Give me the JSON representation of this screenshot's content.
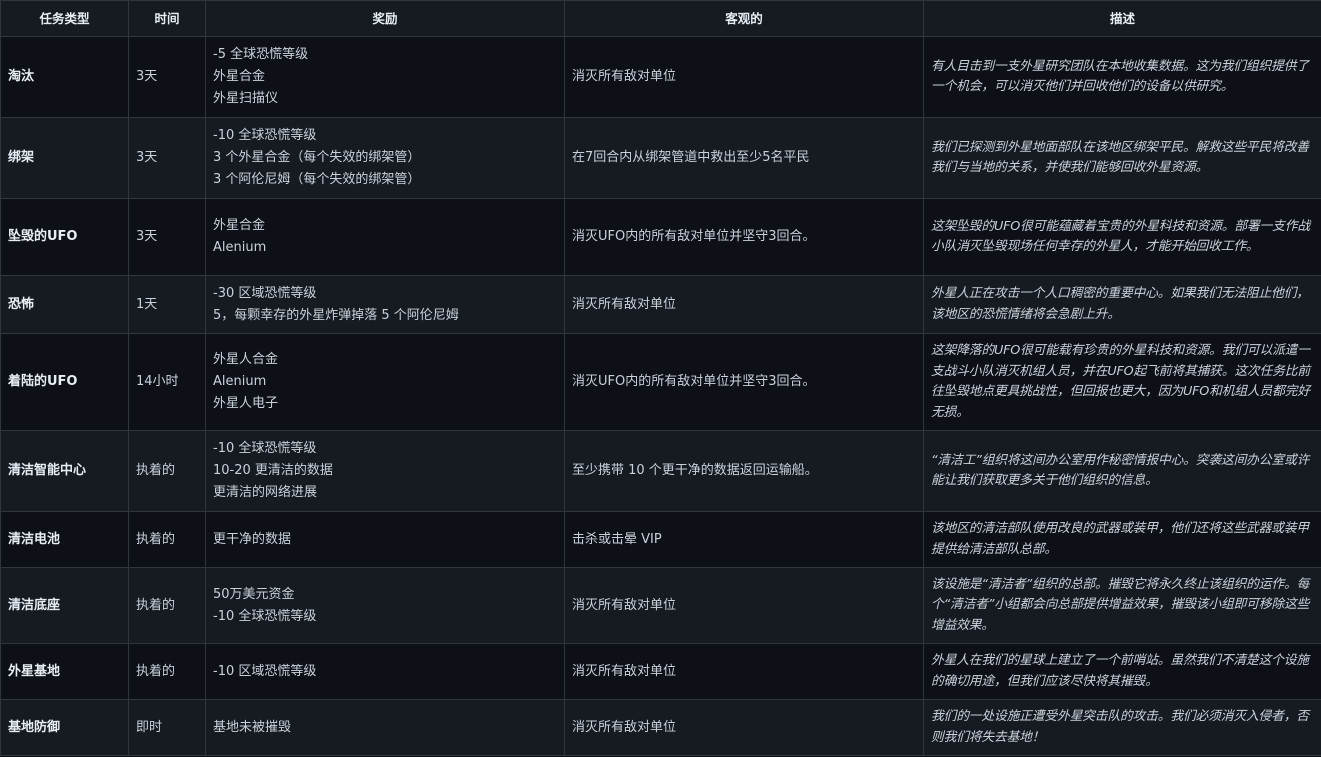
{
  "headers": [
    "任务类型",
    "时间",
    "奖励",
    "客观的",
    "描述"
  ],
  "rows": [
    {
      "type": "淘汰",
      "time": "3天",
      "rewards": [
        "-5 全球恐慌等级",
        "外星合金",
        "外星扫描仪"
      ],
      "objective": "消灭所有敌对单位",
      "description": "有人目击到一支外星研究团队在本地收集数据。这为我们组织提供了一个机会，可以消灭他们并回收他们的设备以供研究。"
    },
    {
      "type": "绑架",
      "time": "3天",
      "rewards": [
        "-10 全球恐慌等级",
        "3 个外星合金（每个失效的绑架管）",
        "3 个阿伦尼姆（每个失效的绑架管）"
      ],
      "objective": "在7回合内从绑架管道中救出至少5名平民",
      "description": "我们已探测到外星地面部队在该地区绑架平民。解救这些平民将改善我们与当地的关系，并使我们能够回收外星资源。"
    },
    {
      "type": "坠毁的UFO",
      "time": "3天",
      "rewards": [
        "外星合金",
        "Alenium"
      ],
      "objective": "消灭UFO内的所有敌对单位并坚守3回合。",
      "description": "这架坠毁的UFO很可能蕴藏着宝贵的外星科技和资源。部署一支作战小队消灭坠毁现场任何幸存的外星人，才能开始回收工作。"
    },
    {
      "type": "恐怖",
      "time": "1天",
      "rewards": [
        "-30 区域恐慌等级",
        "5，每颗幸存的外星炸弹掉落 5 个阿伦尼姆"
      ],
      "objective": "消灭所有敌对单位",
      "description": "外星人正在攻击一个人口稠密的重要中心。如果我们无法阻止他们，该地区的恐慌情绪将会急剧上升。"
    },
    {
      "type": "着陆的UFO",
      "time": "14小时",
      "rewards": [
        "外星人合金",
        "Alenium",
        "外星人电子"
      ],
      "objective": "消灭UFO内的所有敌对单位并坚守3回合。",
      "description": "这架降落的UFO很可能载有珍贵的外星科技和资源。我们可以派遣一支战斗小队消灭机组人员，并在UFO起飞前将其捕获。这次任务比前往坠毁地点更具挑战性，但回报也更大，因为UFO和机组人员都完好无损。"
    },
    {
      "type": "清洁智能中心",
      "time": "执着的",
      "rewards": [
        "-10 全球恐慌等级",
        "10-20 更清洁的数据",
        "更清洁的网络进展"
      ],
      "objective": "至少携带 10 个更干净的数据返回运输船。",
      "description": "“清洁工”组织将这间办公室用作秘密情报中心。突袭这间办公室或许能让我们获取更多关于他们组织的信息。"
    },
    {
      "type": "清洁电池",
      "time": "执着的",
      "rewards": [
        "更干净的数据"
      ],
      "objective": "击杀或击晕 VIP",
      "description": "该地区的清洁部队使用改良的武器或装甲，他们还将这些武器或装甲提供给清洁部队总部。"
    },
    {
      "type": "清洁底座",
      "time": "执着的",
      "rewards": [
        "50万美元资金",
        "-10 全球恐慌等级"
      ],
      "objective": "消灭所有敌对单位",
      "description": "该设施是“清洁者”组织的总部。摧毁它将永久终止该组织的运作。每个“清洁者”小组都会向总部提供增益效果，摧毁该小组即可移除这些增益效果。"
    },
    {
      "type": "外星基地",
      "time": "执着的",
      "rewards": [
        "-10 区域恐慌等级"
      ],
      "objective": "消灭所有敌对单位",
      "description": "外星人在我们的星球上建立了一个前哨站。虽然我们不清楚这个设施的确切用途，但我们应该尽快将其摧毁。"
    },
    {
      "type": "基地防御",
      "time": "即时",
      "rewards": [
        "基地未被摧毁"
      ],
      "objective": "消灭所有敌对单位",
      "description": "我们的一处设施正遭受外星突击队的攻击。我们必须消灭入侵者，否则我们将失去基地！"
    }
  ]
}
